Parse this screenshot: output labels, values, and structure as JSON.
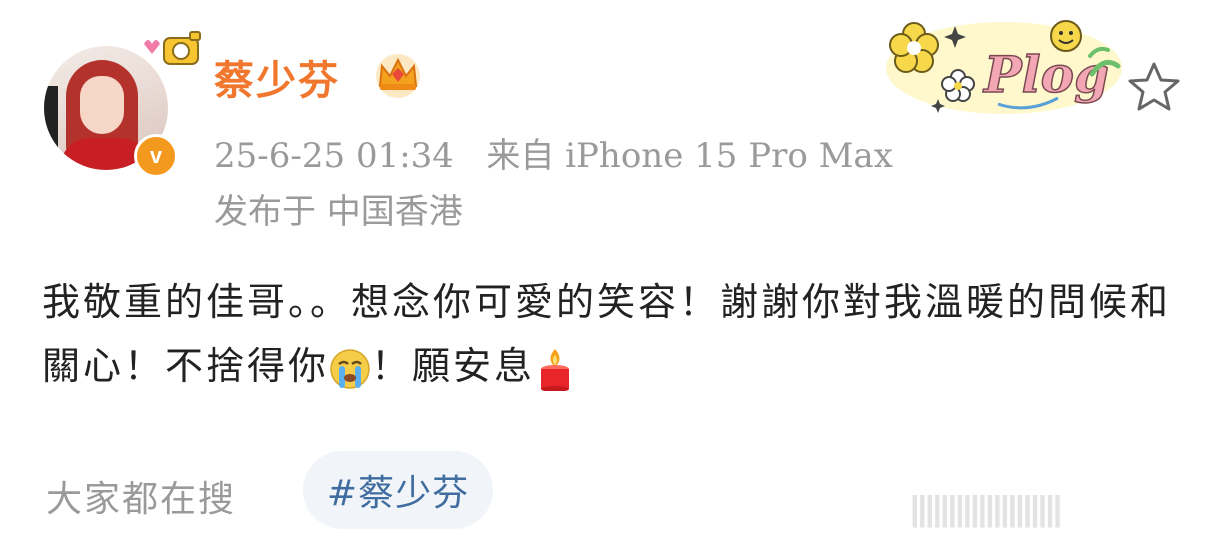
{
  "post": {
    "username": "蔡少芬",
    "timestamp": "25-6-25 01:34",
    "source": "来自 iPhone 15 Pro Max",
    "location": "发布于 中国香港",
    "text_part1": "我敬重的佳哥。。想念你可愛的笑容！謝謝你對我溫暖的問候和關心！不捨得你",
    "text_part2": "！願安息",
    "verified_badge": "v",
    "decoration_text": "Plog"
  },
  "trending": {
    "label": "大家都在搜",
    "tag": "#蔡少芬"
  },
  "watermark": "||||||||||||||||||||",
  "colors": {
    "username": "#f0772d",
    "meta": "#9a9a9a",
    "tag_text": "#3f6d9f",
    "tag_bg": "#f1f4f9",
    "verified": "#f39a1e"
  },
  "icons": [
    "verified-v-icon",
    "crown-icon",
    "plog-sticker-icon",
    "star-favorite-icon",
    "crying-face-emoji",
    "candle-emoji"
  ]
}
